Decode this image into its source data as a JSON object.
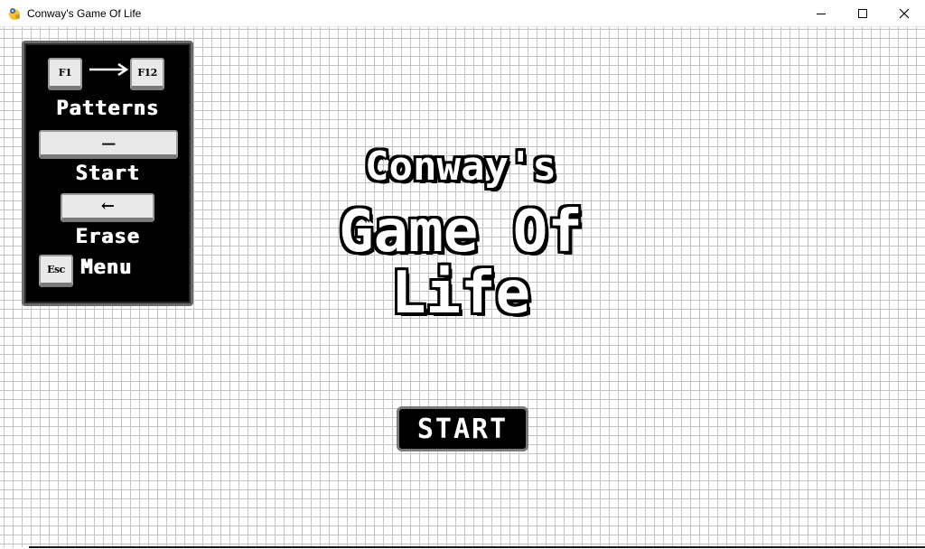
{
  "window": {
    "title": "Conway's Game Of Life",
    "icon": "pygame-snake-icon",
    "controls": [
      "minimize-icon",
      "maximize-icon",
      "close-icon"
    ]
  },
  "help_panel": {
    "pattern_keys": {
      "from": "F1",
      "to": "F12",
      "arrow": "→"
    },
    "patterns_label": "Patterns",
    "space_key": "—",
    "start_label": "Start",
    "backspace_key": "←",
    "erase_label": "Erase",
    "esc_key": "Esc",
    "menu_label": "Menu"
  },
  "title": {
    "line1": "Conway's",
    "line2": "Game Of",
    "line3": "Life"
  },
  "start_button": {
    "label": "START"
  },
  "colors": {
    "grid_line": "#c4c4c4",
    "background": "#ffffff",
    "panel": "#000000",
    "key_face": "#e9e9e9"
  }
}
